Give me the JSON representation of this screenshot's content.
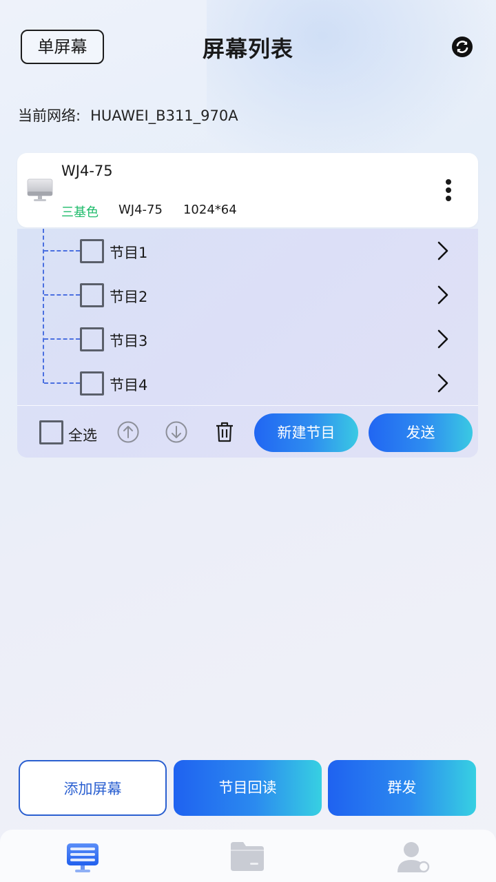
{
  "header": {
    "mode_button": "单屏幕",
    "title": "屏幕列表",
    "refresh_icon": "refresh-icon"
  },
  "network": {
    "label": "当前网络:",
    "ssid": "HUAWEI_B311_970A"
  },
  "screen": {
    "name": "WJ4-75",
    "color_mode": "三基色",
    "model": "WJ4-75",
    "resolution": "1024*64",
    "color_mode_color": "#1dbb6a"
  },
  "programs": [
    {
      "name": "节目1"
    },
    {
      "name": "节目2"
    },
    {
      "name": "节目3"
    },
    {
      "name": "节目4"
    }
  ],
  "toolbar": {
    "select_all": "全选",
    "new_program": "新建节目",
    "send": "发送"
  },
  "actions": {
    "add_screen": "添加屏幕",
    "readback": "节目回读",
    "group_send": "群发"
  },
  "tabs": [
    {
      "icon": "screen-tab-icon",
      "active": true
    },
    {
      "icon": "folder-tab-icon",
      "active": false
    },
    {
      "icon": "user-tab-icon",
      "active": false
    }
  ],
  "colors": {
    "accent_blue": "#2166f2",
    "accent_cyan": "#3ac9e3"
  }
}
